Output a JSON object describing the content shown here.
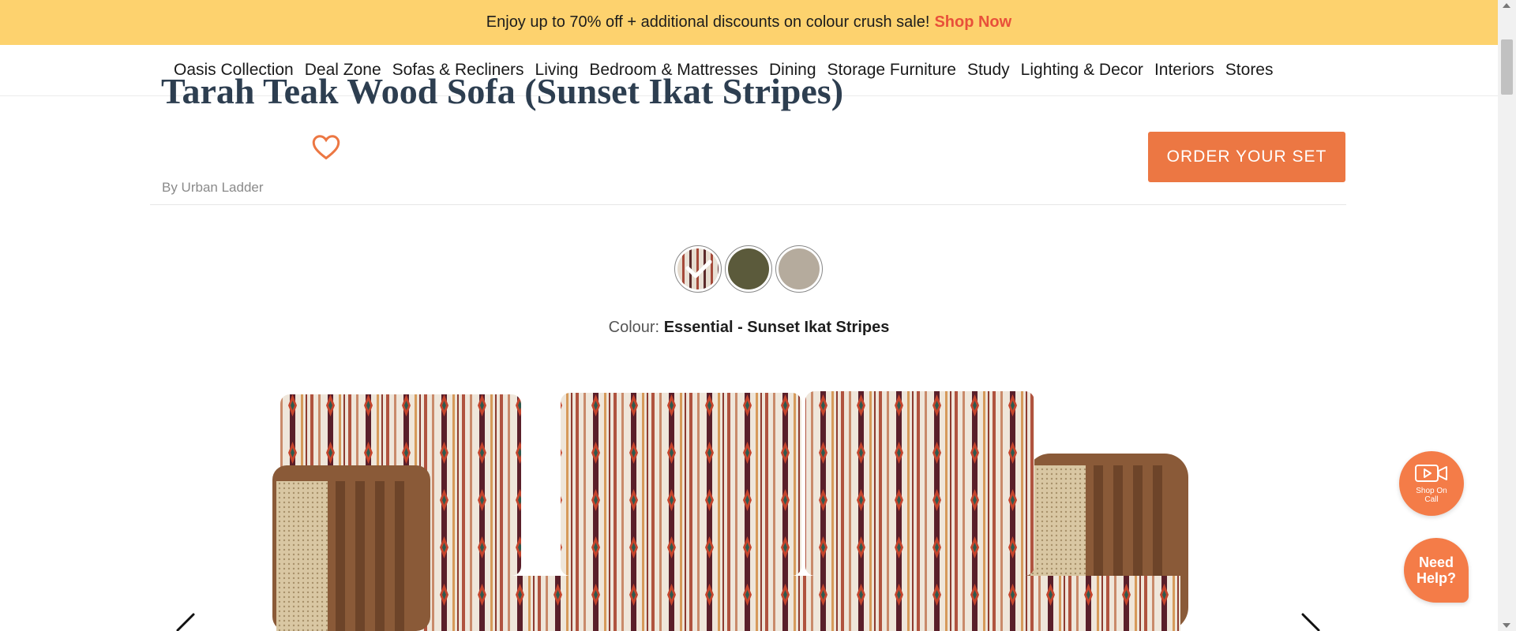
{
  "promo": {
    "text": "Enjoy up to 70% off + additional discounts on colour crush sale!",
    "link_label": "Shop Now"
  },
  "nav": {
    "items": [
      {
        "label": "Oasis Collection"
      },
      {
        "label": "Deal Zone"
      },
      {
        "label": "Sofas & Recliners"
      },
      {
        "label": "Living"
      },
      {
        "label": "Bedroom & Mattresses"
      },
      {
        "label": "Dining"
      },
      {
        "label": "Storage Furniture"
      },
      {
        "label": "Study"
      },
      {
        "label": "Lighting & Decor"
      },
      {
        "label": "Interiors"
      },
      {
        "label": "Stores"
      }
    ]
  },
  "product": {
    "title": "Tarah Teak Wood Sofa (Sunset Ikat Stripes)",
    "brand": "By Urban Ladder",
    "order_button": "ORDER YOUR SET",
    "colour_label": "Colour:",
    "colour_value": "Essential - Sunset Ikat Stripes",
    "swatches": [
      {
        "name": "Sunset Ikat Stripes",
        "selected": true
      },
      {
        "name": "Olive",
        "selected": false
      },
      {
        "name": "Beige",
        "selected": false
      }
    ]
  },
  "floating": {
    "shop_call_label": "Shop On Call",
    "need_help_label": "Need Help?"
  },
  "colors": {
    "promo_bg": "#fdd26e",
    "accent": "#ec7743",
    "promo_link": "#e8503a",
    "title": "#2d3e50"
  },
  "icons": {
    "favourite": "heart-icon",
    "selected_swatch": "check-icon",
    "shop_call": "video-camera-icon",
    "prev": "chevron-left-icon",
    "next": "chevron-right-icon"
  }
}
